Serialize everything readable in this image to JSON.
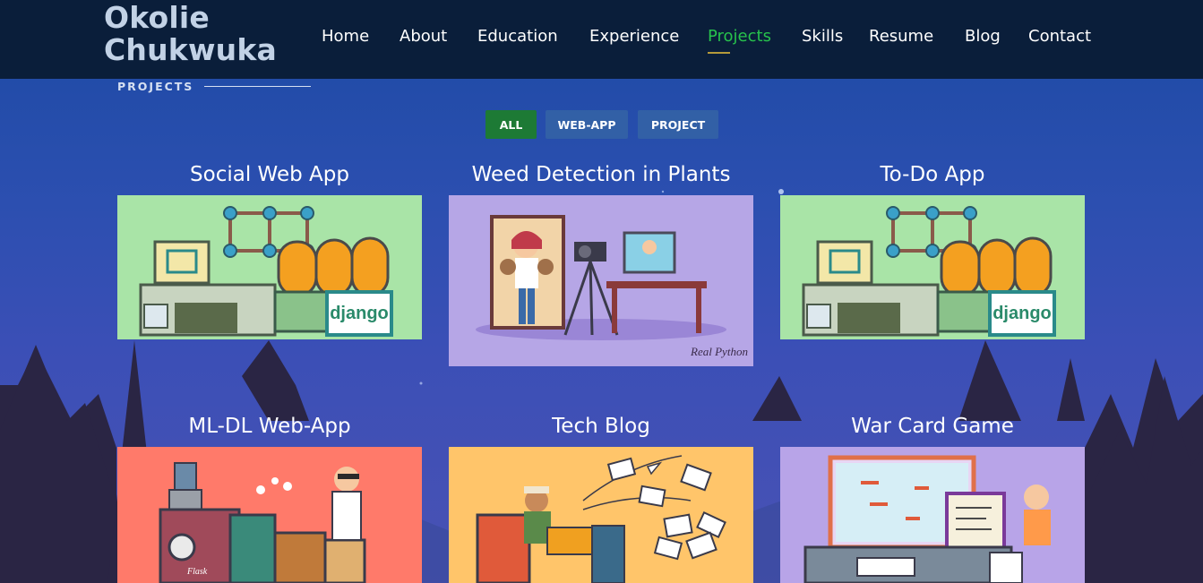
{
  "header": {
    "logo_line1": "Okolie",
    "logo_line2": "Chukwuka",
    "nav": [
      "Home",
      "About",
      "Education",
      "Experience",
      "Projects",
      "Skills",
      "Resume",
      "Blog",
      "Contact"
    ],
    "active_nav": "Projects"
  },
  "section": {
    "title": "PROJECTS"
  },
  "filters": {
    "all": "ALL",
    "webapp": "WEB-APP",
    "project": "PROJECT",
    "active": "ALL"
  },
  "projects": [
    {
      "title": "Social Web App",
      "image": "django-illustration",
      "logo_text": "django"
    },
    {
      "title": "Weed Detection in Plants",
      "image": "camera-illustration",
      "logo_text": "Real Python"
    },
    {
      "title": "To-Do App",
      "image": "django-illustration",
      "logo_text": "django"
    },
    {
      "title": "ML-DL Web-App",
      "image": "flask-illustration",
      "logo_text": "Flask"
    },
    {
      "title": "Tech Blog",
      "image": "email-illustration"
    },
    {
      "title": "War Card Game",
      "image": "game-illustration"
    }
  ],
  "colors": {
    "header_bg": "#0a1e3a",
    "active_nav": "#27c24c",
    "filter_active": "#1d7a35",
    "filter_inactive": "#3260a6"
  }
}
